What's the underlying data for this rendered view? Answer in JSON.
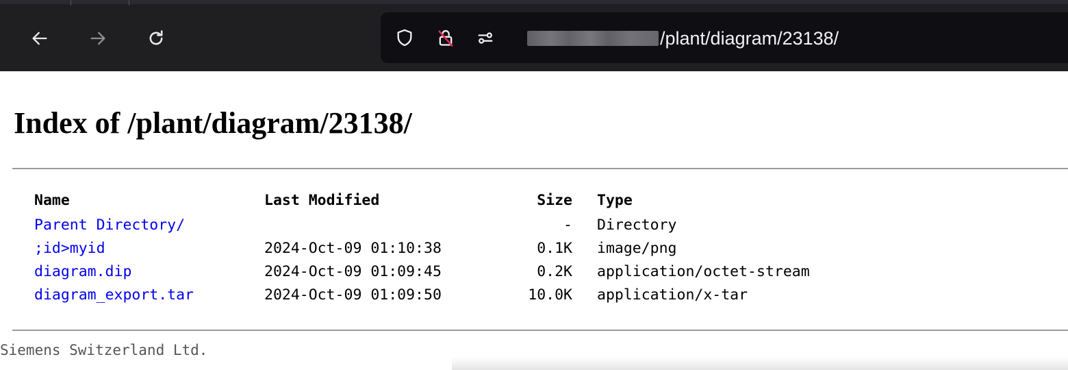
{
  "browser": {
    "back_icon": "arrow-left-icon",
    "forward_icon": "arrow-right-icon",
    "reload_icon": "reload-icon",
    "url_path": "/plant/diagram/23138/",
    "colors": {
      "toolbar": "#1f1f22",
      "url_bar": "#0f0e13",
      "text": "#f2f2f5"
    }
  },
  "page": {
    "title": "Index of /plant/diagram/23138/",
    "columns": {
      "name": "Name",
      "modified": "Last Modified",
      "size": "Size",
      "type": "Type"
    },
    "rows": [
      {
        "name": "Parent Directory/",
        "modified": "",
        "size": "-",
        "type": "Directory"
      },
      {
        "name": ";id>myid",
        "modified": "2024-Oct-09 01:10:38",
        "size": "0.1K",
        "type": "image/png"
      },
      {
        "name": "diagram.dip",
        "modified": "2024-Oct-09 01:09:45",
        "size": "0.2K",
        "type": "application/octet-stream"
      },
      {
        "name": "diagram_export.tar",
        "modified": "2024-Oct-09 01:09:50",
        "size": "10.0K",
        "type": "application/x-tar"
      }
    ],
    "footer": "Siemens Switzerland Ltd.",
    "colors": {
      "link": "#0000ee",
      "footer": "#555555"
    }
  }
}
